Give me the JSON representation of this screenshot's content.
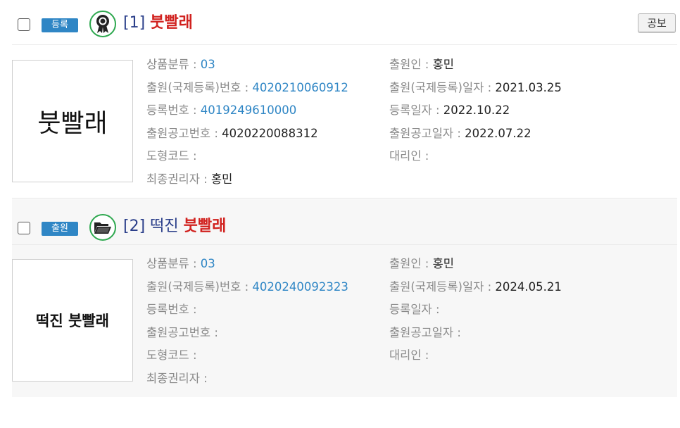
{
  "records": [
    {
      "status_label": "등록",
      "status_icon": "registered-ribbon-icon",
      "number": "[1]",
      "prefix": "",
      "mark": "붓빨래",
      "thumb_text": "붓빨래",
      "action_button": "공보",
      "left_fields": [
        {
          "label": "상품분류",
          "value": "03",
          "is_link": true
        },
        {
          "label": "출원(국제등록)번호",
          "value": "4020210060912",
          "is_link": true
        },
        {
          "label": "등록번호",
          "value": "4019249610000",
          "is_link": true
        },
        {
          "label": "출원공고번호",
          "value": "4020220088312",
          "is_link": false
        },
        {
          "label": "도형코드",
          "value": "",
          "is_link": false
        },
        {
          "label": "최종권리자",
          "value": "홍민",
          "is_link": false
        }
      ],
      "right_fields": [
        {
          "label": "출원인",
          "value": "홍민"
        },
        {
          "label": "출원(국제등록)일자",
          "value": "2021.03.25"
        },
        {
          "label": "등록일자",
          "value": "2022.10.22"
        },
        {
          "label": "출원공고일자",
          "value": "2022.07.22"
        },
        {
          "label": "대리인",
          "value": ""
        }
      ]
    },
    {
      "status_label": "출원",
      "status_icon": "open-folder-icon",
      "number": "[2]",
      "prefix": "떡진",
      "mark": "붓빨래",
      "thumb_text": "떡진 붓빨래",
      "left_fields": [
        {
          "label": "상품분류",
          "value": "03",
          "is_link": true
        },
        {
          "label": "출원(국제등록)번호",
          "value": "4020240092323",
          "is_link": true
        },
        {
          "label": "등록번호",
          "value": "",
          "is_link": false
        },
        {
          "label": "출원공고번호",
          "value": "",
          "is_link": false
        },
        {
          "label": "도형코드",
          "value": "",
          "is_link": false
        },
        {
          "label": "최종권리자",
          "value": "",
          "is_link": false
        }
      ],
      "right_fields": [
        {
          "label": "출원인",
          "value": "홍민"
        },
        {
          "label": "출원(국제등록)일자",
          "value": "2024.05.21"
        },
        {
          "label": "등록일자",
          "value": ""
        },
        {
          "label": "출원공고일자",
          "value": ""
        },
        {
          "label": "대리인",
          "value": ""
        }
      ]
    }
  ],
  "colors": {
    "badge": "#2f86c5",
    "icon_ring": "#2ea84f",
    "title_blue": "#2b3f8a",
    "mark_red": "#d1221f",
    "link": "#2f86c5"
  }
}
